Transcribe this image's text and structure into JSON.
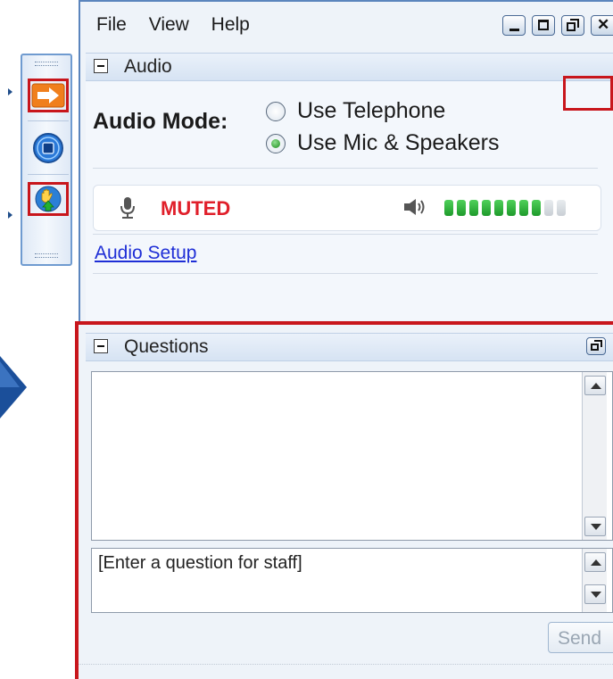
{
  "menu": {
    "file": "File",
    "view": "View",
    "help": "Help"
  },
  "audio_section": {
    "title": "Audio",
    "mode_label": "Audio Mode:",
    "options": [
      "Use Telephone",
      "Use Mic & Speakers"
    ],
    "selected_option": "Use Mic & Speakers",
    "mic_status": "MUTED",
    "speaker_level": 0.8,
    "setup_link": "Audio Setup"
  },
  "questions_section": {
    "title": "Questions",
    "input_placeholder": "[Enter a question for staff]",
    "send_label": "Send"
  },
  "colors": {
    "highlight_red": "#c8161c",
    "muted_red": "#e01f2a",
    "meter_green": "#1e9a2b",
    "link_blue": "#1e2ed6"
  }
}
